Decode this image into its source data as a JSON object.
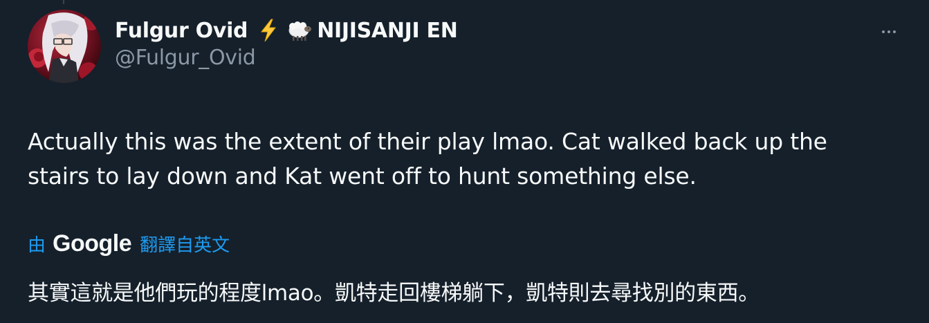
{
  "user": {
    "display_name": "Fulgur Ovid",
    "name_emojis": [
      "lightning-emoji",
      "sheep-emoji"
    ],
    "name_suffix": "NIJISANJI EN",
    "handle": "@Fulgur_Ovid"
  },
  "tweet": {
    "text": "Actually this was the extent of their play lmao. Cat walked back up the stairs to lay down and Kat went off to hunt something else."
  },
  "translation": {
    "by_label": "由",
    "provider": "Google",
    "from_label": "翻譯自英文",
    "text": "其實這就是他們玩的程度lmao。凱特走回樓梯躺下，凱特則去尋找別的東西。"
  },
  "colors": {
    "background": "#15202b",
    "text_primary": "#f7f9f9",
    "text_secondary": "#8b98a5",
    "accent": "#1d9bf0"
  }
}
